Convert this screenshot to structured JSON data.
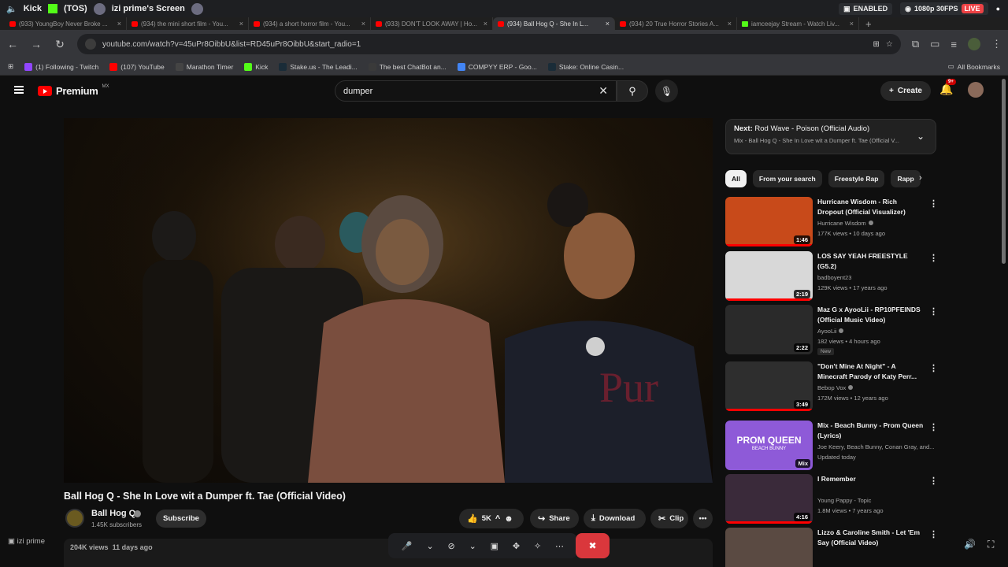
{
  "stream_bar": {
    "server": "Kick",
    "server_tag": "(TOS)",
    "screen_title": "izi prime's Screen",
    "enabled_label": "ENABLED",
    "quality_label": "1080p 30FPS",
    "live_label": "LIVE"
  },
  "browser": {
    "tabs": [
      {
        "title": "(933) YoungBoy Never Broke ...",
        "active": false
      },
      {
        "title": "(934) the mini short film - You...",
        "active": false
      },
      {
        "title": "(934) a short horror film - You...",
        "active": false
      },
      {
        "title": "(933) DON'T LOOK AWAY | Ho...",
        "active": false
      },
      {
        "title": "(934) Ball Hog Q - She In L...",
        "active": true
      },
      {
        "title": "(934) 20 True Horror Stories A...",
        "active": false
      },
      {
        "title": "iamceejay Stream - Watch Liv...",
        "active": false,
        "kick": true
      }
    ],
    "new_tab": "+",
    "url": "youtube.com/watch?v=45uPr8OibbU&list=RD45uPr8OibbU&start_radio=1",
    "bookmarks": [
      {
        "label": "(1) Following - Twitch",
        "color": "#9146ff"
      },
      {
        "label": "(107) YouTube",
        "color": "#ff0000"
      },
      {
        "label": "Marathon Timer",
        "color": "#444444"
      },
      {
        "label": "Kick",
        "color": "#53fc18"
      },
      {
        "label": "Stake.us - The Leadi...",
        "color": "#1a2c38"
      },
      {
        "label": "The best ChatBot an...",
        "color": "#3a3a3a"
      },
      {
        "label": "COMPYY ERP - Goo...",
        "color": "#4285f4"
      },
      {
        "label": "Stake: Online Casin...",
        "color": "#1a2c38"
      }
    ],
    "all_bookmarks": "All Bookmarks"
  },
  "youtube": {
    "logo_text": "Premium",
    "country": "MX",
    "search_query": "dumper",
    "create_label": "Create",
    "notif_badge": "9+"
  },
  "video": {
    "title": "Ball Hog Q - She In Love wit a Dumper ft. Tae (Official Video)",
    "channel": "Ball Hog Q",
    "subscribers": "1.45K subscribers",
    "subscribe_label": "Subscribe",
    "likes": "5K",
    "share_label": "Share",
    "download_label": "Download",
    "clip_label": "Clip",
    "views": "204K views",
    "age": "11 days ago"
  },
  "overlay": {
    "streamer": "izi prime"
  },
  "sidebar": {
    "up_next_prefix": "Next:",
    "up_next_title": "Rod Wave - Poison (Official Audio)",
    "up_next_sub": "Mix - Ball Hog Q - She In Love wit a Dumper ft. Tae (Official V...",
    "chips": [
      "All",
      "From your search",
      "Freestyle Rap",
      "Rapp"
    ],
    "recommendations": [
      {
        "title": "Hurricane Wisdom - Rich Dropout (Official Visualizer)",
        "channel": "Hurricane Wisdom",
        "verified": true,
        "meta": "177K views • 10 days ago",
        "duration": "1:46",
        "progress": 1.0,
        "thumb": "#c84a1a"
      },
      {
        "title": "LOS SAY YEAH FREESTYLE (G5.2)",
        "channel": "badboyent23",
        "verified": false,
        "meta": "129K views • 17 years ago",
        "duration": "2:19",
        "progress": 1.0,
        "thumb": "#d8d8d8"
      },
      {
        "title": "Maz G x AyooLii - RP10PFEINDS (Official Music Video)",
        "channel": "AyooLii",
        "verified": true,
        "meta": "182 views • 4 hours ago",
        "duration": "2:22",
        "progress": 0.0,
        "badge_new": "New",
        "thumb": "#2a2a2a"
      },
      {
        "title": "\"Don't Mine At Night\" - A Minecraft Parody of Katy Perr...",
        "channel": "Bebop Vox",
        "verified": true,
        "meta": "172M views • 12 years ago",
        "duration": "3:49",
        "progress": 1.0,
        "thumb": "#2e2e2e"
      },
      {
        "title": "Mix - Beach Bunny - Prom Queen (Lyrics)",
        "channel": "Joe Keery, Beach Bunny, Conan Gray, and...",
        "verified": false,
        "meta": "Updated today",
        "duration": "Mix",
        "progress": 0.0,
        "thumb": "#8e5ad8",
        "thumb_text": "PROM QUEEN",
        "thumb_sub": "BEACH BUNNY"
      },
      {
        "title": "I Remember",
        "channel": "Young Pappy - Topic",
        "verified": false,
        "meta": "1.8M views • 7 years ago",
        "duration": "4:16",
        "progress": 1.0,
        "thumb": "#3a2a3a"
      },
      {
        "title": "Lizzo & Caroline Smith - Let 'Em Say (Official Video)",
        "channel": "",
        "verified": false,
        "meta": "",
        "duration": "",
        "progress": 0.0,
        "thumb": "#5a4a42"
      }
    ]
  }
}
